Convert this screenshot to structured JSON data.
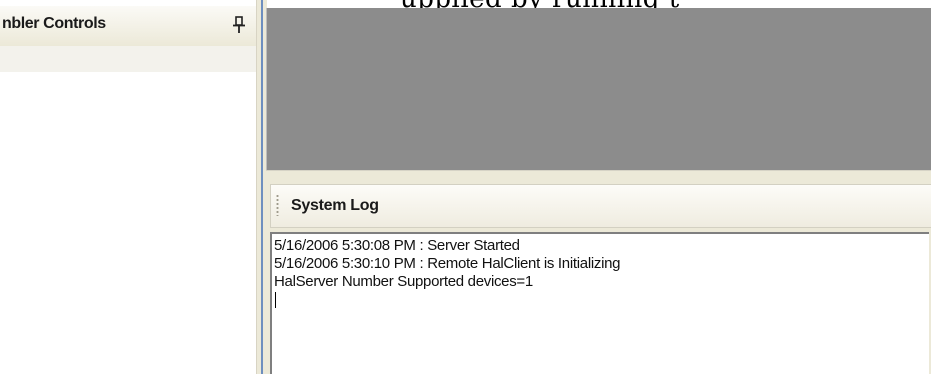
{
  "top_caption": "upplied by running t",
  "left_panel": {
    "title": "nbler Controls",
    "pin_icon": "pin-icon"
  },
  "log_panel": {
    "title": "System Log",
    "lines": [
      "5/16/2006 5:30:08 PM : Server Started",
      "5/16/2006 5:30:10 PM : Remote HalClient is Initializing",
      "HalServer Number Supported devices=1"
    ]
  },
  "colors": {
    "workspace": "#8c8c8c",
    "panel_chrome": "#ece9d8",
    "splitter_accent": "#6e8fbf"
  }
}
